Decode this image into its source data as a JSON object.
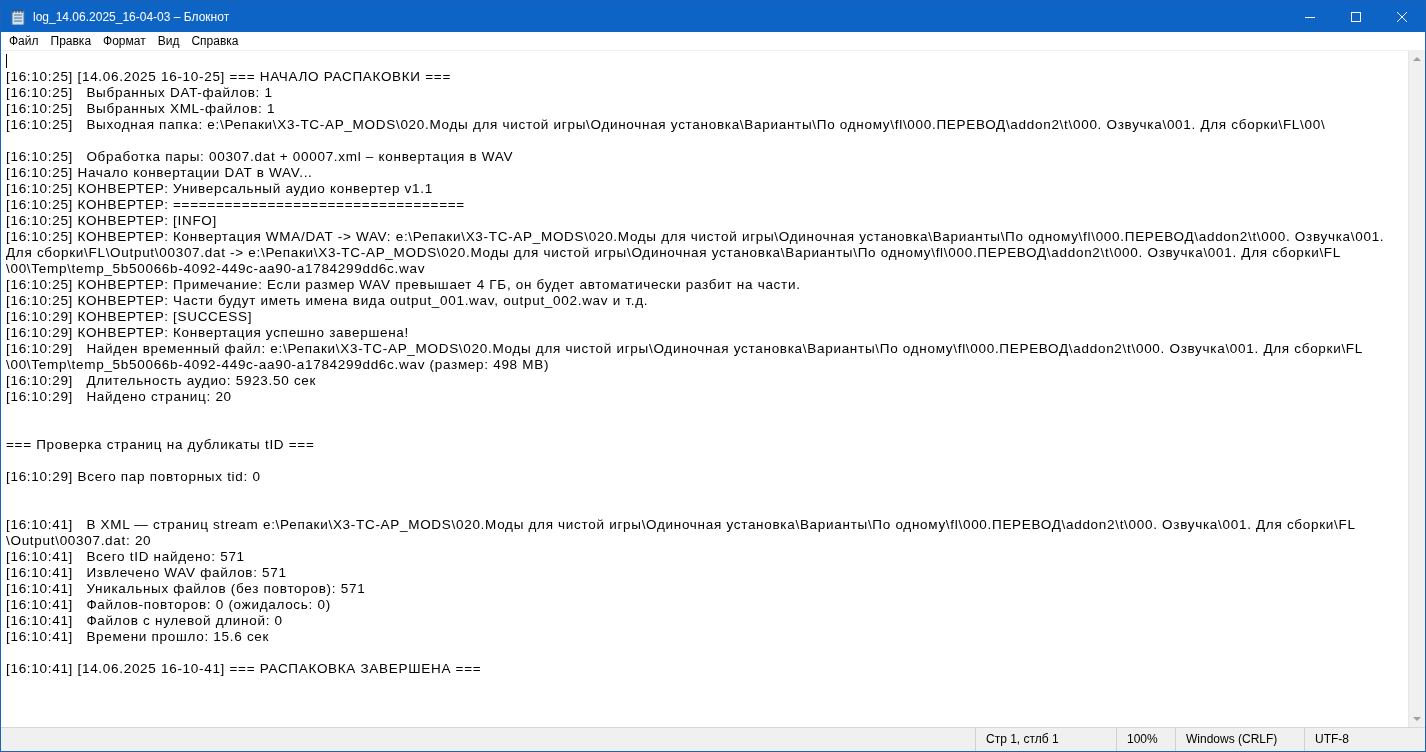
{
  "window": {
    "title": "log_14.06.2025_16-04-03 – Блокнот"
  },
  "menu": [
    "Файл",
    "Правка",
    "Формат",
    "Вид",
    "Справка"
  ],
  "editor": {
    "lines": [
      {
        "kind": "cursor"
      },
      {
        "kind": "line",
        "text": "[16:10:25] [14.06.2025 16-10-25] === НАЧАЛО РАСПАКОВКИ ==="
      },
      {
        "kind": "line",
        "text": "[16:10:25]   Выбранных DAT-файлов: 1"
      },
      {
        "kind": "line",
        "text": "[16:10:25]   Выбранных XML-файлов: 1"
      },
      {
        "kind": "line",
        "text": "[16:10:25]   Выходная папка: e:\\Репаки\\X3-TC-AP_MODS\\020.Моды для чистой игры\\Одиночная установка\\Варианты\\По одному\\fl\\000.ПЕРЕВОД\\addon2\\t\\000. Озвучка\\001. Для сборки\\FL\\00\\"
      },
      {
        "kind": "blank"
      },
      {
        "kind": "line",
        "text": "[16:10:25]   Обработка пары: 00307.dat + 00007.xml – конвертация в WAV"
      },
      {
        "kind": "line",
        "text": "[16:10:25] Начало конвертации DAT в WAV..."
      },
      {
        "kind": "line",
        "text": "[16:10:25] КОНВЕРТЕР: Универсальный аудио конвертер v1.1"
      },
      {
        "kind": "line",
        "text": "[16:10:25] КОНВЕРТЕР: =================================="
      },
      {
        "kind": "line",
        "text": "[16:10:25] КОНВЕРТЕР: [INFO]"
      },
      {
        "kind": "line",
        "text": "[16:10:25] КОНВЕРТЕР: Конвертация WMA/DAT -> WAV: e:\\Репаки\\X3-TC-AP_MODS\\020.Моды для чистой игры\\Одиночная установка\\Варианты\\По одному\\fl\\000.ПЕРЕВОД\\addon2\\t\\000. Озвучка\\001."
      },
      {
        "kind": "line",
        "text": "Для сборки\\FL\\Output\\00307.dat -> e:\\Репаки\\X3-TC-AP_MODS\\020.Моды для чистой игры\\Одиночная установка\\Варианты\\По одному\\fl\\000.ПЕРЕВОД\\addon2\\t\\000. Озвучка\\001. Для сборки\\FL"
      },
      {
        "kind": "line",
        "text": "\\00\\Temp\\temp_5b50066b-4092-449c-aa90-a1784299dd6c.wav"
      },
      {
        "kind": "line",
        "text": "[16:10:25] КОНВЕРТЕР: Примечание: Если размер WAV превышает 4 ГБ, он будет автоматически разбит на части."
      },
      {
        "kind": "line",
        "text": "[16:10:25] КОНВЕРТЕР: Части будут иметь имена вида output_001.wav, output_002.wav и т.д."
      },
      {
        "kind": "line",
        "text": "[16:10:29] КОНВЕРТЕР: [SUCCESS]"
      },
      {
        "kind": "line",
        "text": "[16:10:29] КОНВЕРТЕР: Конвертация успешно завершена!"
      },
      {
        "kind": "line",
        "text": "[16:10:29]   Найден временный файл: e:\\Репаки\\X3-TC-AP_MODS\\020.Моды для чистой игры\\Одиночная установка\\Варианты\\По одному\\fl\\000.ПЕРЕВОД\\addon2\\t\\000. Озвучка\\001. Для сборки\\FL"
      },
      {
        "kind": "line",
        "text": "\\00\\Temp\\temp_5b50066b-4092-449c-aa90-a1784299dd6c.wav (размер: 498 MB)"
      },
      {
        "kind": "line",
        "text": "[16:10:29]   Длительность аудио: 5923.50 сек"
      },
      {
        "kind": "line",
        "text": "[16:10:29]   Найдено страниц: 20"
      },
      {
        "kind": "blank"
      },
      {
        "kind": "blank"
      },
      {
        "kind": "line",
        "text": "=== Проверка страниц на дубликаты tID ==="
      },
      {
        "kind": "blank"
      },
      {
        "kind": "line",
        "text": "[16:10:29] Всего пар повторных tid: 0"
      },
      {
        "kind": "blank"
      },
      {
        "kind": "blank"
      },
      {
        "kind": "line",
        "text": "[16:10:41]   В XML — страниц stream e:\\Репаки\\X3-TC-AP_MODS\\020.Моды для чистой игры\\Одиночная установка\\Варианты\\По одному\\fl\\000.ПЕРЕВОД\\addon2\\t\\000. Озвучка\\001. Для сборки\\FL"
      },
      {
        "kind": "line",
        "text": "\\Output\\00307.dat: 20"
      },
      {
        "kind": "line",
        "text": "[16:10:41]   Всего tID найдено: 571"
      },
      {
        "kind": "line",
        "text": "[16:10:41]   Извлечено WAV файлов: 571"
      },
      {
        "kind": "line",
        "text": "[16:10:41]   Уникальных файлов (без повторов): 571"
      },
      {
        "kind": "line",
        "text": "[16:10:41]   Файлов-повторов: 0 (ожидалось: 0)"
      },
      {
        "kind": "line",
        "text": "[16:10:41]   Файлов с нулевой длиной: 0"
      },
      {
        "kind": "line",
        "text": "[16:10:41]   Времени прошло: 15.6 сек"
      },
      {
        "kind": "blank"
      },
      {
        "kind": "line",
        "text": "[16:10:41] [14.06.2025 16-10-41] === РАСПАКОВКА ЗАВЕРШЕНА ==="
      }
    ]
  },
  "status_bar": [
    "Стр 1, стлб 1",
    "100%",
    "Windows (CRLF)",
    "UTF-8"
  ]
}
